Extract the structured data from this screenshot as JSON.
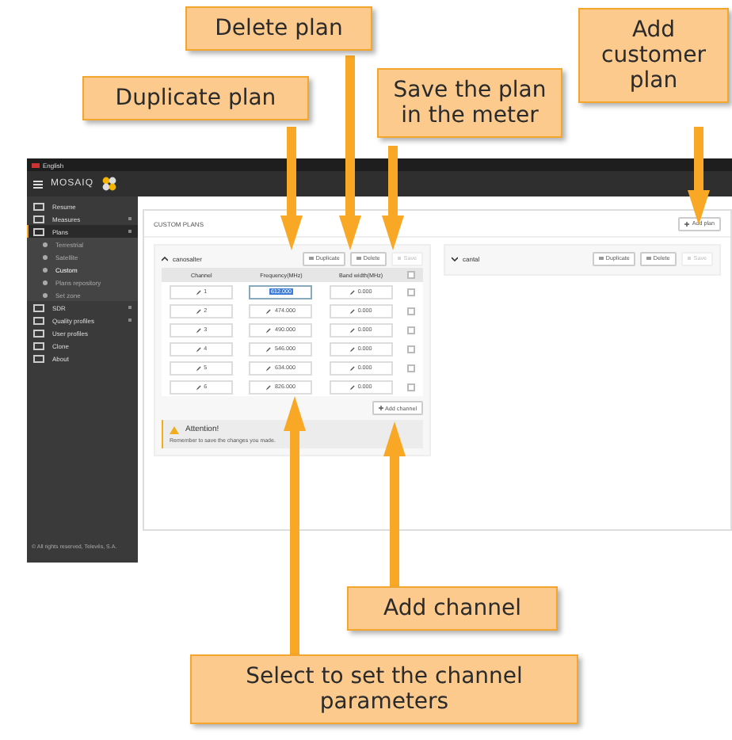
{
  "annotations": [
    {
      "text": "Delete plan"
    },
    {
      "text": "Duplicate plan"
    },
    {
      "text": "Save the plan in the meter"
    },
    {
      "text": "Add customer plan"
    },
    {
      "text": "Add channel"
    },
    {
      "text": "Select to set the channel parameters"
    }
  ],
  "top_bar": {
    "language": "English"
  },
  "header": {
    "logo": "MOSAIQ"
  },
  "sidebar": {
    "items": [
      {
        "label": "Resume",
        "selected": false,
        "has_submenu": false
      },
      {
        "label": "Measures",
        "selected": false,
        "has_submenu": true
      },
      {
        "label": "Plans",
        "selected": true,
        "has_submenu": true,
        "children": [
          {
            "label": "Terrestrial",
            "selected": false
          },
          {
            "label": "Satellite",
            "selected": false
          },
          {
            "label": "Custom",
            "selected": true
          },
          {
            "label": "Plans repository",
            "selected": false
          },
          {
            "label": "Set zone",
            "selected": false
          }
        ]
      },
      {
        "label": "SDR",
        "selected": false,
        "has_submenu": true
      },
      {
        "label": "Quality profiles",
        "selected": false,
        "has_submenu": true
      },
      {
        "label": "User profiles",
        "selected": false,
        "has_submenu": false
      },
      {
        "label": "Clone",
        "selected": false,
        "has_submenu": false
      },
      {
        "label": "About",
        "selected": false,
        "has_submenu": false
      }
    ],
    "footer": "© All rights reserved, Televés, S.A."
  },
  "main": {
    "title": "CUSTOM PLANS",
    "add_button": "Add plan",
    "plans": [
      {
        "name": "canosalter",
        "expanded": true,
        "buttons": [
          {
            "label": "Duplicate",
            "disabled": false
          },
          {
            "label": "Delete",
            "disabled": false
          },
          {
            "label": "Save",
            "disabled": true
          }
        ],
        "columns": [
          "Channel",
          "Frequency(MHz)",
          "Band width(MHz)"
        ],
        "all_checked": false,
        "rows": [
          {
            "channel": "1",
            "frequency": "612.000",
            "bandwidth": "0.000",
            "frequency_selected": true,
            "checked": false
          },
          {
            "channel": "2",
            "frequency": "474.000",
            "bandwidth": "0.000",
            "frequency_selected": false,
            "checked": false
          },
          {
            "channel": "3",
            "frequency": "490.000",
            "bandwidth": "0.000",
            "frequency_selected": false,
            "checked": false
          },
          {
            "channel": "4",
            "frequency": "546.000",
            "bandwidth": "0.000",
            "frequency_selected": false,
            "checked": false
          },
          {
            "channel": "5",
            "frequency": "634.000",
            "bandwidth": "0.000",
            "frequency_selected": false,
            "checked": false
          },
          {
            "channel": "6",
            "frequency": "826.000",
            "bandwidth": "0.000",
            "frequency_selected": false,
            "checked": false
          }
        ],
        "add_channel": "Add channel",
        "alert": {
          "title": "Attention!",
          "message": "Remember to save the changes you made."
        }
      },
      {
        "name": "cantal",
        "expanded": false,
        "buttons": [
          {
            "label": "Duplicate",
            "disabled": false
          },
          {
            "label": "Delete",
            "disabled": false
          },
          {
            "label": "Save",
            "disabled": true
          }
        ]
      }
    ]
  }
}
